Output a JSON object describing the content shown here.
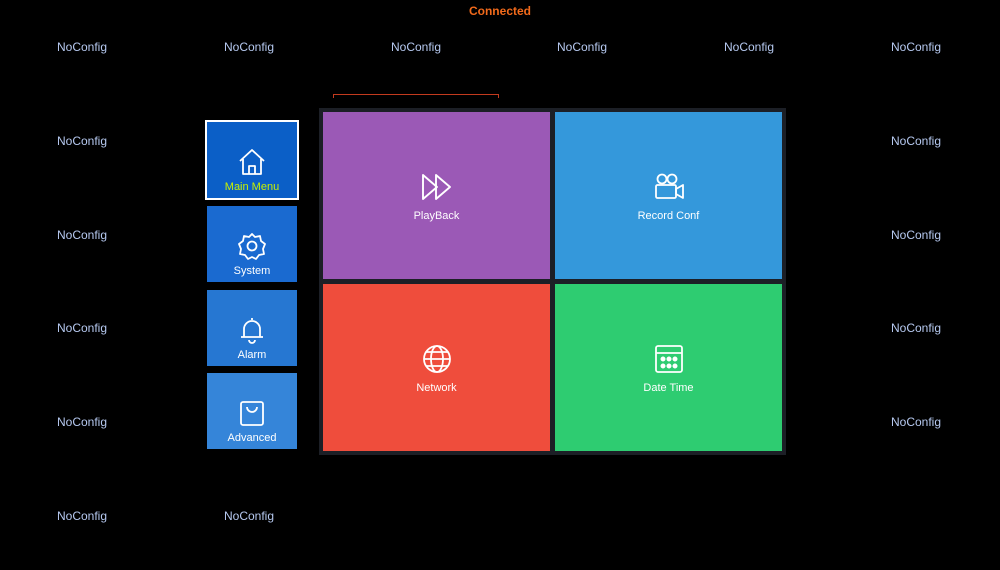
{
  "status": {
    "text": "Connected",
    "color": "#f26a1b"
  },
  "channels": {
    "top_row": [
      "NoConfig",
      "NoConfig",
      "NoConfig",
      "NoConfig",
      "NoConfig",
      "NoConfig"
    ],
    "left_col": [
      "NoConfig",
      "NoConfig",
      "NoConfig",
      "NoConfig"
    ],
    "right_col": [
      "NoConfig",
      "NoConfig",
      "NoConfig",
      "NoConfig"
    ],
    "bottom_row": [
      "NoConfig",
      "NoConfig"
    ]
  },
  "sidebar": {
    "items": [
      {
        "label": "Main Menu",
        "icon": "home-icon",
        "active": true,
        "color": "#0b5fc7"
      },
      {
        "label": "System",
        "icon": "gear-icon",
        "active": false,
        "color": "#1a6ad0"
      },
      {
        "label": "Alarm",
        "icon": "bell-icon",
        "active": false,
        "color": "#2677d2"
      },
      {
        "label": "Advanced",
        "icon": "bag-icon",
        "active": false,
        "color": "#3585d9"
      }
    ]
  },
  "tiles": [
    {
      "label": "PlayBack",
      "icon": "fast-forward-icon",
      "color": "#9b59b6"
    },
    {
      "label": "Record Conf",
      "icon": "video-camera-icon",
      "color": "#3498db"
    },
    {
      "label": "Network",
      "icon": "globe-icon",
      "color": "#ef4d3c"
    },
    {
      "label": "Date Time",
      "icon": "calendar-icon",
      "color": "#2ecc71"
    }
  ]
}
